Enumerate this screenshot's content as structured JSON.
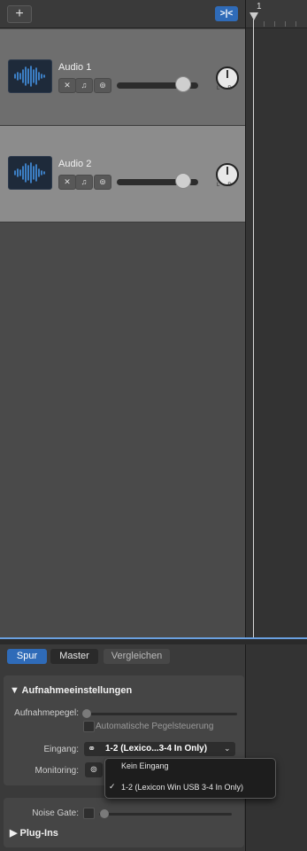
{
  "header": {
    "add_label": "+",
    "filter_label": ">|<",
    "ruler_bar": "1"
  },
  "tracks": [
    {
      "name": "Audio 1",
      "volume": 0.8,
      "selected": false
    },
    {
      "name": "Audio 2",
      "volume": 0.8,
      "selected": true
    }
  ],
  "inspector": {
    "tabs": [
      {
        "label": "Spur",
        "active": true
      },
      {
        "label": "Master",
        "active": false
      },
      {
        "label": "Vergleichen",
        "active": false
      }
    ],
    "recording": {
      "title": "Aufnahmeeinstellungen",
      "level_label": "Aufnahmepegel:",
      "auto_level_label": "Automatische Pegelsteuerung",
      "input_label": "Eingang:",
      "input_value": "1-2  (Lexico...3-4 In Only)",
      "monitoring_label": "Monitoring:"
    },
    "input_menu": {
      "items": [
        {
          "label": "Kein Eingang",
          "checked": false
        },
        {
          "label": "1-2  (Lexicon Win USB 3-4 In Only)",
          "checked": true
        }
      ],
      "check": "✓"
    },
    "noise_gate_label": "Noise Gate:",
    "plugins_label": "Plug-Ins"
  },
  "colors": {
    "accent": "#2f6bb8",
    "track_selected": "#8c8c8c",
    "track_normal": "#6e6e6e"
  }
}
